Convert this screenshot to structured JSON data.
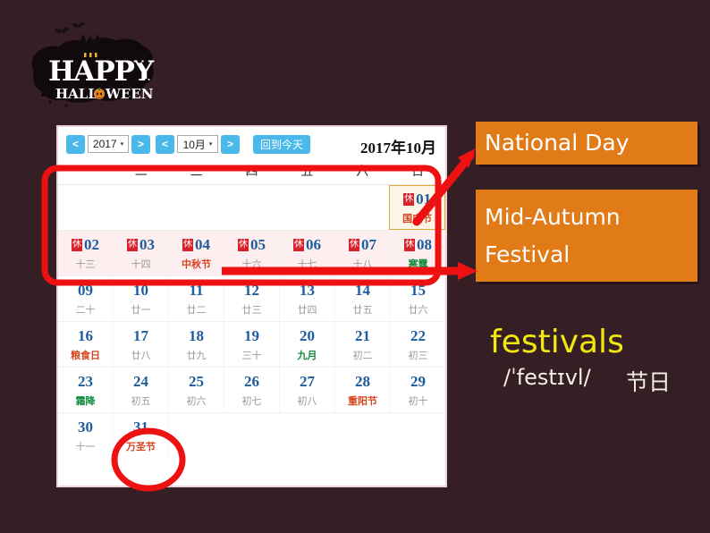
{
  "theme": {
    "background": "#351F24",
    "accent_orange": "#E07B18",
    "annotation_red": "#EE1111",
    "word_yellow": "#F2E711",
    "day_number_blue": "#1F5C9E",
    "rest_badge_red": "#D6232B"
  },
  "logo": {
    "line1": "HAPPY",
    "line2": "HALLOWEEN",
    "alt": "happy-halloween-logo"
  },
  "calendar": {
    "toolbar": {
      "prev_year_label": "<",
      "next_year_label": ">",
      "prev_month_label": "<",
      "next_month_label": ">",
      "year_value": "2017",
      "month_value": "10月",
      "caret": "▾",
      "today_button": "回到今天"
    },
    "title": "2017年10月",
    "weekdays": [
      "一",
      "二",
      "三",
      "四",
      "五",
      "六",
      "日"
    ],
    "rest_badge": "休",
    "weeks": [
      {
        "shaded": false,
        "days": [
          {
            "empty": true
          },
          {
            "empty": true
          },
          {
            "empty": true
          },
          {
            "empty": true
          },
          {
            "empty": true
          },
          {
            "empty": true
          },
          {
            "num": "01",
            "lunar": "国庆节",
            "lunar_style": "red",
            "rest": true,
            "highlight": true
          }
        ]
      },
      {
        "shaded": true,
        "days": [
          {
            "num": "02",
            "lunar": "十三",
            "lunar_style": "",
            "rest": true
          },
          {
            "num": "03",
            "lunar": "十四",
            "lunar_style": "",
            "rest": true
          },
          {
            "num": "04",
            "lunar": "中秋节",
            "lunar_style": "red",
            "rest": true
          },
          {
            "num": "05",
            "lunar": "十六",
            "lunar_style": "",
            "rest": true
          },
          {
            "num": "06",
            "lunar": "十七",
            "lunar_style": "",
            "rest": true
          },
          {
            "num": "07",
            "lunar": "十八",
            "lunar_style": "",
            "rest": true
          },
          {
            "num": "08",
            "lunar": "寒露",
            "lunar_style": "green",
            "rest": true
          }
        ]
      },
      {
        "shaded": false,
        "days": [
          {
            "num": "09",
            "lunar": "二十",
            "lunar_style": ""
          },
          {
            "num": "10",
            "lunar": "廿一",
            "lunar_style": ""
          },
          {
            "num": "11",
            "lunar": "廿二",
            "lunar_style": ""
          },
          {
            "num": "12",
            "lunar": "廿三",
            "lunar_style": ""
          },
          {
            "num": "13",
            "lunar": "廿四",
            "lunar_style": ""
          },
          {
            "num": "14",
            "lunar": "廿五",
            "lunar_style": ""
          },
          {
            "num": "15",
            "lunar": "廿六",
            "lunar_style": ""
          }
        ]
      },
      {
        "shaded": false,
        "days": [
          {
            "num": "16",
            "lunar": "粮食日",
            "lunar_style": "red"
          },
          {
            "num": "17",
            "lunar": "廿八",
            "lunar_style": ""
          },
          {
            "num": "18",
            "lunar": "廿九",
            "lunar_style": ""
          },
          {
            "num": "19",
            "lunar": "三十",
            "lunar_style": ""
          },
          {
            "num": "20",
            "lunar": "九月",
            "lunar_style": "green"
          },
          {
            "num": "21",
            "lunar": "初二",
            "lunar_style": ""
          },
          {
            "num": "22",
            "lunar": "初三",
            "lunar_style": ""
          }
        ]
      },
      {
        "shaded": false,
        "days": [
          {
            "num": "23",
            "lunar": "霜降",
            "lunar_style": "green"
          },
          {
            "num": "24",
            "lunar": "初五",
            "lunar_style": ""
          },
          {
            "num": "25",
            "lunar": "初六",
            "lunar_style": ""
          },
          {
            "num": "26",
            "lunar": "初七",
            "lunar_style": ""
          },
          {
            "num": "27",
            "lunar": "初八",
            "lunar_style": ""
          },
          {
            "num": "28",
            "lunar": "重阳节",
            "lunar_style": "red"
          },
          {
            "num": "29",
            "lunar": "初十",
            "lunar_style": ""
          }
        ]
      },
      {
        "shaded": false,
        "days": [
          {
            "num": "30",
            "lunar": "十一",
            "lunar_style": ""
          },
          {
            "num": "31",
            "lunar": "万圣节",
            "lunar_style": "red"
          },
          {
            "empty": true
          },
          {
            "empty": true
          },
          {
            "empty": true
          },
          {
            "empty": true
          },
          {
            "empty": true
          }
        ]
      }
    ]
  },
  "callouts": {
    "national_day": "National Day",
    "mid_autumn_line1": "Mid-Autumn",
    "mid_autumn_line2": "Festival"
  },
  "vocabulary": {
    "word": "festivals",
    "phonetic": "/ˈfestɪvl/",
    "translation": "节日"
  },
  "annotations": {
    "rectangle": "red-highlight-rectangle",
    "arrow_up_right": "arrow-to-national-day",
    "arrow_right": "arrow-to-mid-autumn-festival",
    "circle": "red-circle-on-halloween-date"
  }
}
